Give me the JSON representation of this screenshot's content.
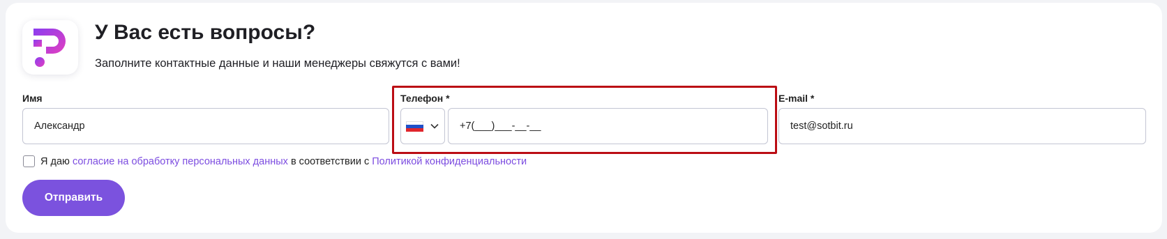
{
  "header": {
    "title": "У Вас есть вопросы?",
    "subtitle": "Заполните контактные данные и наши менеджеры свяжутся с вами!",
    "logo_icon": "question-mark-logo"
  },
  "form": {
    "name": {
      "label": "Имя",
      "value": "Александр"
    },
    "phone": {
      "label": "Телефон *",
      "country_flag_icon": "russia-flag-icon",
      "value": "+7(___)___-__-__"
    },
    "email": {
      "label": "E-mail *",
      "value": "test@sotbit.ru"
    },
    "consent": {
      "text_before": "Я даю",
      "link1": "согласие на обработку персональных данных",
      "text_middle": "в соответствии с",
      "link2": "Политикой конфиденциальности"
    },
    "submit_label": "Отправить"
  },
  "colors": {
    "accent": "#7b52de",
    "link": "#7c4ce0",
    "highlight_border": "#bb0d14",
    "flag_white": "#ffffff",
    "flag_blue": "#1f50c8",
    "flag_red": "#e0262c"
  }
}
